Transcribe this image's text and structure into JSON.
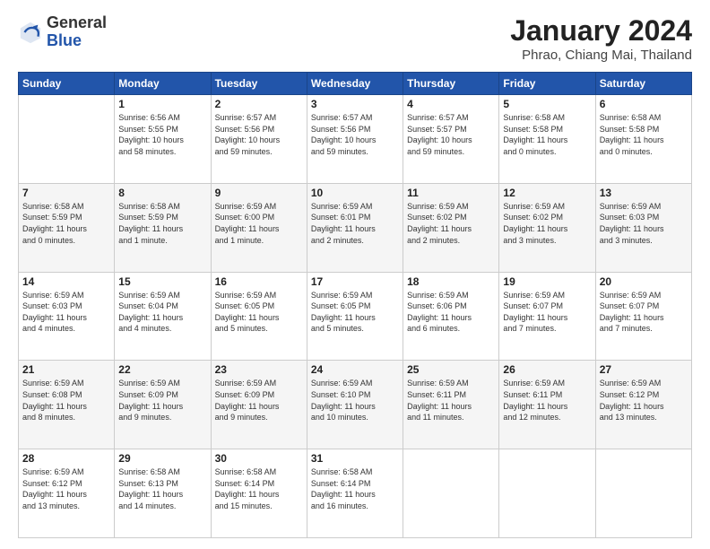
{
  "header": {
    "logo_general": "General",
    "logo_blue": "Blue",
    "month_title": "January 2024",
    "subtitle": "Phrao, Chiang Mai, Thailand"
  },
  "weekdays": [
    "Sunday",
    "Monday",
    "Tuesday",
    "Wednesday",
    "Thursday",
    "Friday",
    "Saturday"
  ],
  "weeks": [
    [
      {
        "day": "",
        "info": ""
      },
      {
        "day": "1",
        "info": "Sunrise: 6:56 AM\nSunset: 5:55 PM\nDaylight: 10 hours\nand 58 minutes."
      },
      {
        "day": "2",
        "info": "Sunrise: 6:57 AM\nSunset: 5:56 PM\nDaylight: 10 hours\nand 59 minutes."
      },
      {
        "day": "3",
        "info": "Sunrise: 6:57 AM\nSunset: 5:56 PM\nDaylight: 10 hours\nand 59 minutes."
      },
      {
        "day": "4",
        "info": "Sunrise: 6:57 AM\nSunset: 5:57 PM\nDaylight: 10 hours\nand 59 minutes."
      },
      {
        "day": "5",
        "info": "Sunrise: 6:58 AM\nSunset: 5:58 PM\nDaylight: 11 hours\nand 0 minutes."
      },
      {
        "day": "6",
        "info": "Sunrise: 6:58 AM\nSunset: 5:58 PM\nDaylight: 11 hours\nand 0 minutes."
      }
    ],
    [
      {
        "day": "7",
        "info": "Sunrise: 6:58 AM\nSunset: 5:59 PM\nDaylight: 11 hours\nand 0 minutes."
      },
      {
        "day": "8",
        "info": "Sunrise: 6:58 AM\nSunset: 5:59 PM\nDaylight: 11 hours\nand 1 minute."
      },
      {
        "day": "9",
        "info": "Sunrise: 6:59 AM\nSunset: 6:00 PM\nDaylight: 11 hours\nand 1 minute."
      },
      {
        "day": "10",
        "info": "Sunrise: 6:59 AM\nSunset: 6:01 PM\nDaylight: 11 hours\nand 2 minutes."
      },
      {
        "day": "11",
        "info": "Sunrise: 6:59 AM\nSunset: 6:02 PM\nDaylight: 11 hours\nand 2 minutes."
      },
      {
        "day": "12",
        "info": "Sunrise: 6:59 AM\nSunset: 6:02 PM\nDaylight: 11 hours\nand 3 minutes."
      },
      {
        "day": "13",
        "info": "Sunrise: 6:59 AM\nSunset: 6:03 PM\nDaylight: 11 hours\nand 3 minutes."
      }
    ],
    [
      {
        "day": "14",
        "info": "Sunrise: 6:59 AM\nSunset: 6:03 PM\nDaylight: 11 hours\nand 4 minutes."
      },
      {
        "day": "15",
        "info": "Sunrise: 6:59 AM\nSunset: 6:04 PM\nDaylight: 11 hours\nand 4 minutes."
      },
      {
        "day": "16",
        "info": "Sunrise: 6:59 AM\nSunset: 6:05 PM\nDaylight: 11 hours\nand 5 minutes."
      },
      {
        "day": "17",
        "info": "Sunrise: 6:59 AM\nSunset: 6:05 PM\nDaylight: 11 hours\nand 5 minutes."
      },
      {
        "day": "18",
        "info": "Sunrise: 6:59 AM\nSunset: 6:06 PM\nDaylight: 11 hours\nand 6 minutes."
      },
      {
        "day": "19",
        "info": "Sunrise: 6:59 AM\nSunset: 6:07 PM\nDaylight: 11 hours\nand 7 minutes."
      },
      {
        "day": "20",
        "info": "Sunrise: 6:59 AM\nSunset: 6:07 PM\nDaylight: 11 hours\nand 7 minutes."
      }
    ],
    [
      {
        "day": "21",
        "info": "Sunrise: 6:59 AM\nSunset: 6:08 PM\nDaylight: 11 hours\nand 8 minutes."
      },
      {
        "day": "22",
        "info": "Sunrise: 6:59 AM\nSunset: 6:09 PM\nDaylight: 11 hours\nand 9 minutes."
      },
      {
        "day": "23",
        "info": "Sunrise: 6:59 AM\nSunset: 6:09 PM\nDaylight: 11 hours\nand 9 minutes."
      },
      {
        "day": "24",
        "info": "Sunrise: 6:59 AM\nSunset: 6:10 PM\nDaylight: 11 hours\nand 10 minutes."
      },
      {
        "day": "25",
        "info": "Sunrise: 6:59 AM\nSunset: 6:11 PM\nDaylight: 11 hours\nand 11 minutes."
      },
      {
        "day": "26",
        "info": "Sunrise: 6:59 AM\nSunset: 6:11 PM\nDaylight: 11 hours\nand 12 minutes."
      },
      {
        "day": "27",
        "info": "Sunrise: 6:59 AM\nSunset: 6:12 PM\nDaylight: 11 hours\nand 13 minutes."
      }
    ],
    [
      {
        "day": "28",
        "info": "Sunrise: 6:59 AM\nSunset: 6:12 PM\nDaylight: 11 hours\nand 13 minutes."
      },
      {
        "day": "29",
        "info": "Sunrise: 6:58 AM\nSunset: 6:13 PM\nDaylight: 11 hours\nand 14 minutes."
      },
      {
        "day": "30",
        "info": "Sunrise: 6:58 AM\nSunset: 6:14 PM\nDaylight: 11 hours\nand 15 minutes."
      },
      {
        "day": "31",
        "info": "Sunrise: 6:58 AM\nSunset: 6:14 PM\nDaylight: 11 hours\nand 16 minutes."
      },
      {
        "day": "",
        "info": ""
      },
      {
        "day": "",
        "info": ""
      },
      {
        "day": "",
        "info": ""
      }
    ]
  ]
}
